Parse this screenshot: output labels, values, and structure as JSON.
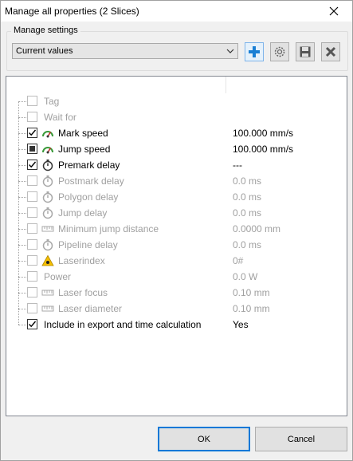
{
  "window": {
    "title": "Manage all properties (2 Slices)"
  },
  "manage_settings": {
    "legend": "Manage settings",
    "preset_value": "Current values",
    "buttons": [
      "add-icon",
      "gear-icon",
      "save-icon",
      "delete-icon"
    ]
  },
  "properties": [
    {
      "label": "Tag",
      "value": "",
      "checked": false,
      "enabled": false,
      "icon": null
    },
    {
      "label": "Wait for",
      "value": "",
      "checked": false,
      "enabled": false,
      "icon": null
    },
    {
      "label": "Mark speed",
      "value": "100.000 mm/s",
      "checked": true,
      "enabled": true,
      "icon": "speedometer-icon"
    },
    {
      "label": "Jump speed",
      "value": "100.000 mm/s",
      "checked": "mixed",
      "enabled": true,
      "icon": "speedometer-icon"
    },
    {
      "label": "Premark delay",
      "value": "---",
      "checked": true,
      "enabled": true,
      "icon": "stopwatch-icon"
    },
    {
      "label": "Postmark delay",
      "value": "0.0 ms",
      "checked": false,
      "enabled": false,
      "icon": "stopwatch-icon"
    },
    {
      "label": "Polygon delay",
      "value": "0.0 ms",
      "checked": false,
      "enabled": false,
      "icon": "stopwatch-icon"
    },
    {
      "label": "Jump delay",
      "value": "0.0 ms",
      "checked": false,
      "enabled": false,
      "icon": "stopwatch-icon"
    },
    {
      "label": "Minimum jump distance",
      "value": "0.0000 mm",
      "checked": false,
      "enabled": false,
      "icon": "ruler-icon"
    },
    {
      "label": "Pipeline delay",
      "value": "0.0 ms",
      "checked": false,
      "enabled": false,
      "icon": "stopwatch-icon"
    },
    {
      "label": "Laserindex",
      "value": "0#",
      "checked": false,
      "enabled": false,
      "icon": "laser-warning-icon"
    },
    {
      "label": "Power",
      "value": "0.0 W",
      "checked": false,
      "enabled": false,
      "icon": null
    },
    {
      "label": "Laser focus",
      "value": "0.10 mm",
      "checked": false,
      "enabled": false,
      "icon": "ruler-icon"
    },
    {
      "label": "Laser diameter",
      "value": "0.10 mm",
      "checked": false,
      "enabled": false,
      "icon": "ruler-icon"
    },
    {
      "label": "Include in export and time calculation",
      "value": "Yes",
      "checked": true,
      "enabled": true,
      "icon": null
    }
  ],
  "footer": {
    "ok_label": "OK",
    "cancel_label": "Cancel"
  },
  "colors": {
    "accent": "#0078d7",
    "disabled_text": "#a0a0a0",
    "add_blue": "#1a7fd4"
  }
}
